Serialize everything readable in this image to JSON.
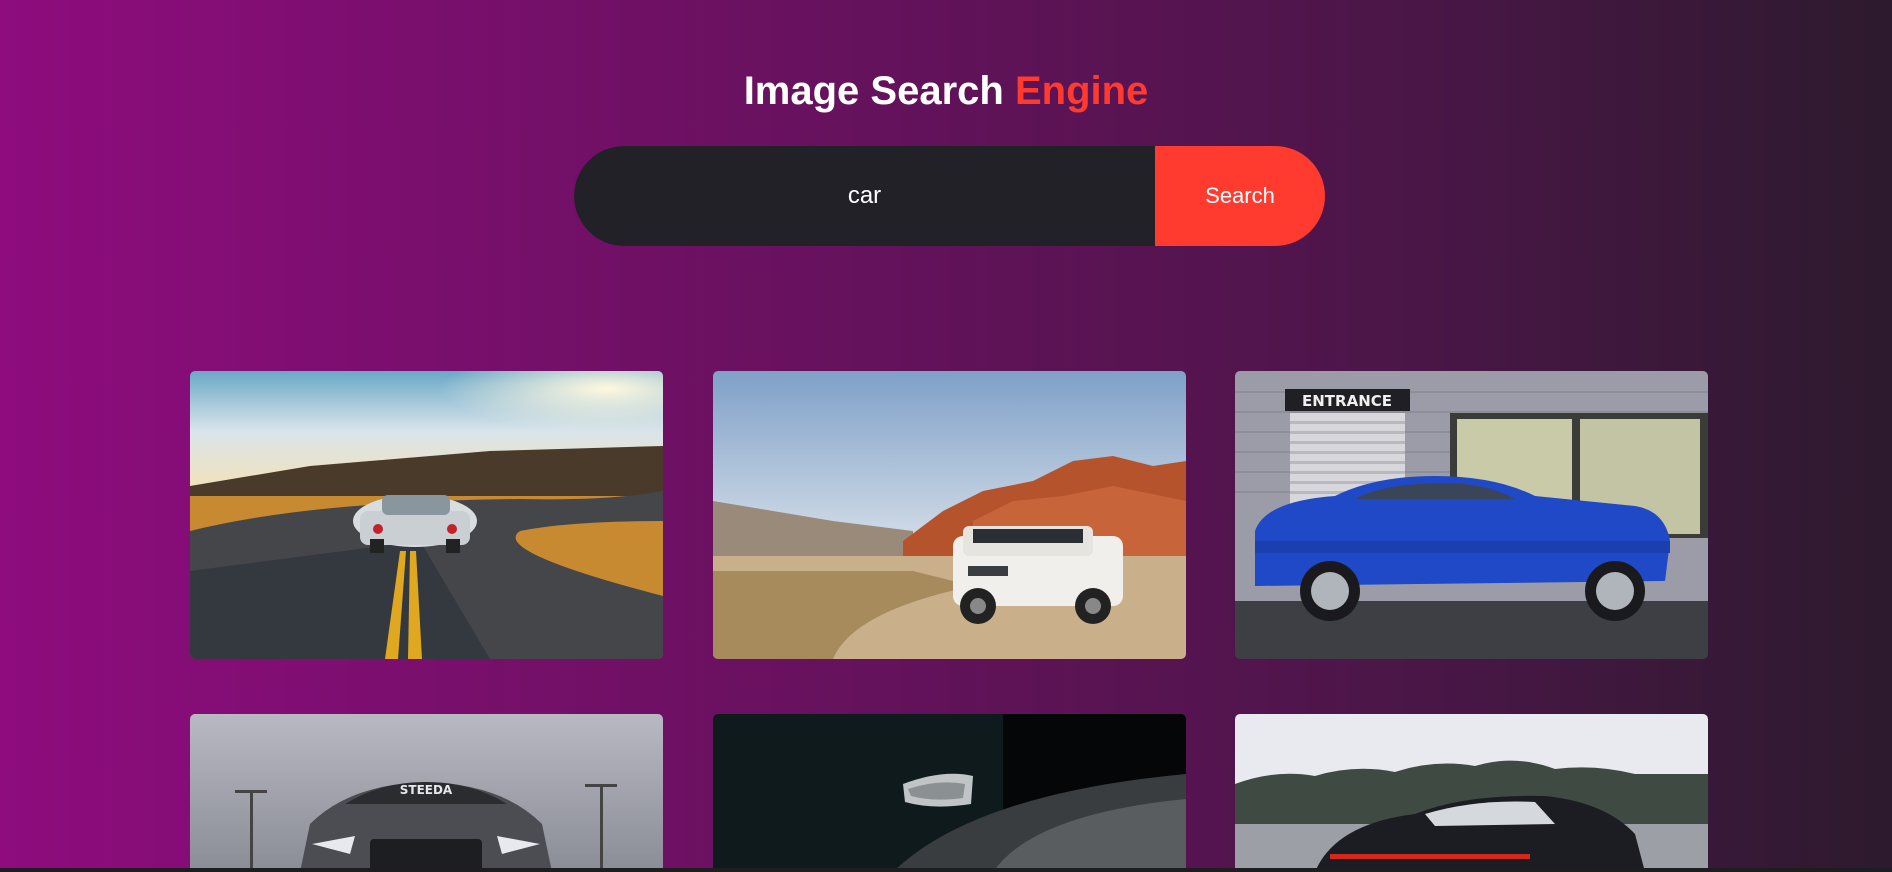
{
  "header": {
    "title_main": "Image Search",
    "title_accent": "Engine"
  },
  "search": {
    "value": "car",
    "button_label": "Search"
  },
  "results": [
    {
      "subject": "white sports car on winding road at sunset"
    },
    {
      "subject": "white SUV in desert with red rocks"
    },
    {
      "subject": "blue coupe in front of building",
      "sign": "ENTRANCE"
    },
    {
      "subject": "grey muscle car front view",
      "windshield": "STEEDA"
    },
    {
      "subject": "dark car close-up side mirror"
    },
    {
      "subject": "dark sedan rear view on road"
    }
  ],
  "colors": {
    "accent": "#ff3a2e",
    "input_bg": "#232128",
    "gradient_start": "#8e0c7e",
    "gradient_end": "#2d1a2e"
  }
}
